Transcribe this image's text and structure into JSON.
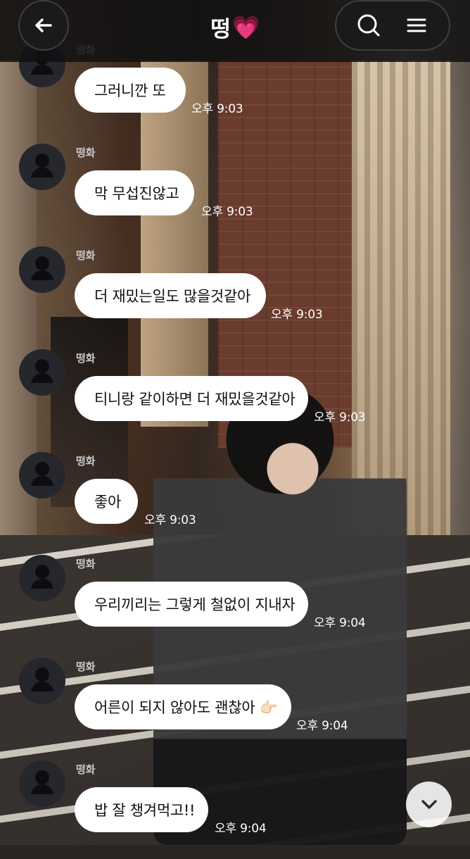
{
  "header": {
    "title": "떵",
    "heart": "💗",
    "back_icon": "arrow-left-icon",
    "search_icon": "search-icon",
    "menu_icon": "hamburger-menu-icon"
  },
  "messages": [
    {
      "sender": "떵화",
      "text": "그러니깐 또",
      "time": "오후 9:03"
    },
    {
      "sender": "떵화",
      "text": "막 무섭진않고",
      "time": "오후 9:03"
    },
    {
      "sender": "떵화",
      "text": "더 재밌는일도 많을것같아",
      "time": "오후 9:03"
    },
    {
      "sender": "떵화",
      "text": "티니랑 같이하면 더 재밌을것같아",
      "time": "오후 9:03"
    },
    {
      "sender": "떵화",
      "text": "좋아",
      "time": "오후 9:03"
    },
    {
      "sender": "떵화",
      "text": "우리끼리는 그렇게 철없이 지내자",
      "time": "오후 9:04"
    },
    {
      "sender": "떵화",
      "text": "어른이 되지 않아도 괜찮아 👉🏻",
      "time": "오후 9:04"
    },
    {
      "sender": "떵화",
      "text": "밥 잘 챙겨먹고!!",
      "time": "오후 9:04"
    }
  ],
  "scroll_button_icon": "chevron-down-icon",
  "colors": {
    "header_bg": "#101012",
    "bubble_bg": "#ffffff",
    "heart": "#ff2ca8"
  }
}
